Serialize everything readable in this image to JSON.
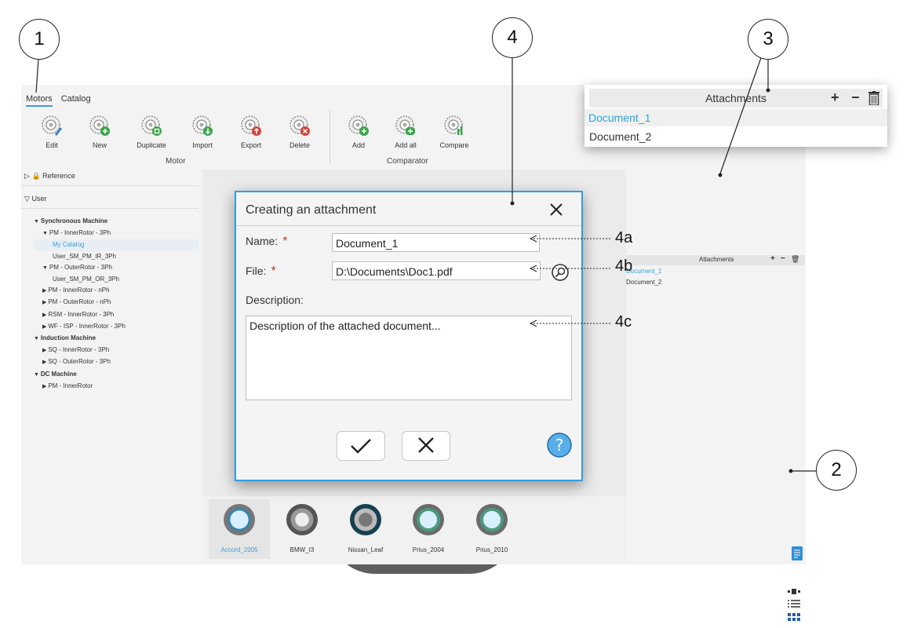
{
  "tabs": [
    "Motors",
    "Catalog"
  ],
  "toolbar": {
    "motor_group": [
      "Edit",
      "New",
      "Duplicate",
      "Import",
      "Export",
      "Delete"
    ],
    "motor_group_label": "Motor",
    "comparator_group": [
      "Add",
      "Add all",
      "Compare"
    ],
    "comparator_group_label": "Comparator"
  },
  "left_panel": {
    "reference_label": "Reference",
    "user_label": "User",
    "tree": [
      {
        "text": "Synchronous Machine",
        "level": 0,
        "bold": true,
        "arrow": "down"
      },
      {
        "text": "PM - InnerRotor - 3Ph",
        "level": 1,
        "arrow": "down"
      },
      {
        "text": "My Catalog",
        "level": 2,
        "selected": true
      },
      {
        "text": "User_SM_PM_IR_3Ph",
        "level": 2
      },
      {
        "text": "PM - OuterRotor - 3Ph",
        "level": 1,
        "arrow": "down"
      },
      {
        "text": "User_SM_PM_OR_3Ph",
        "level": 2
      },
      {
        "text": "PM - InnerRotor - nPh",
        "level": 1,
        "arrow": "right"
      },
      {
        "text": "PM - OuterRotor - nPh",
        "level": 1,
        "arrow": "right"
      },
      {
        "text": "RSM - InnerRotor - 3Ph",
        "level": 1,
        "arrow": "right"
      },
      {
        "text": "WF - ISP - InnerRotor - 3Ph",
        "level": 1,
        "arrow": "right"
      },
      {
        "text": "Induction Machine",
        "level": 0,
        "bold": true,
        "arrow": "down"
      },
      {
        "text": "SQ - InnerRotor - 3Ph",
        "level": 1,
        "arrow": "right"
      },
      {
        "text": "SQ - OuterRotor - 3Ph",
        "level": 1,
        "arrow": "right"
      },
      {
        "text": "DC Machine",
        "level": 0,
        "bold": true,
        "arrow": "down"
      },
      {
        "text": "PM - InnerRotor",
        "level": 1,
        "arrow": "right"
      }
    ]
  },
  "thumbnails": [
    "Accord_2005",
    "BMW_I3",
    "Nissan_Leaf",
    "Prius_2004",
    "Prius_2010"
  ],
  "attachments_small": {
    "title": "Attachments",
    "items": [
      "Document_1",
      "Document_2"
    ]
  },
  "attachments_big": {
    "title": "Attachments",
    "items": [
      "Document_1",
      "Document_2"
    ]
  },
  "dialog": {
    "title": "Creating an attachment",
    "name_label": "Name:",
    "name_value": "Document_1",
    "file_label": "File:",
    "file_value": "D:\\Documents\\Doc1.pdf",
    "description_label": "Description:",
    "description_value": "Description of the attached document...",
    "required_mark": "*"
  },
  "callouts": {
    "c1": "1",
    "c2": "2",
    "c3": "3",
    "c4": "4",
    "n4a": "4a",
    "n4b": "4b",
    "n4c": "4c"
  },
  "colors": {
    "accent": "#2f9ee0",
    "selected_text": "#3aa0d8",
    "required": "#c0392b"
  }
}
